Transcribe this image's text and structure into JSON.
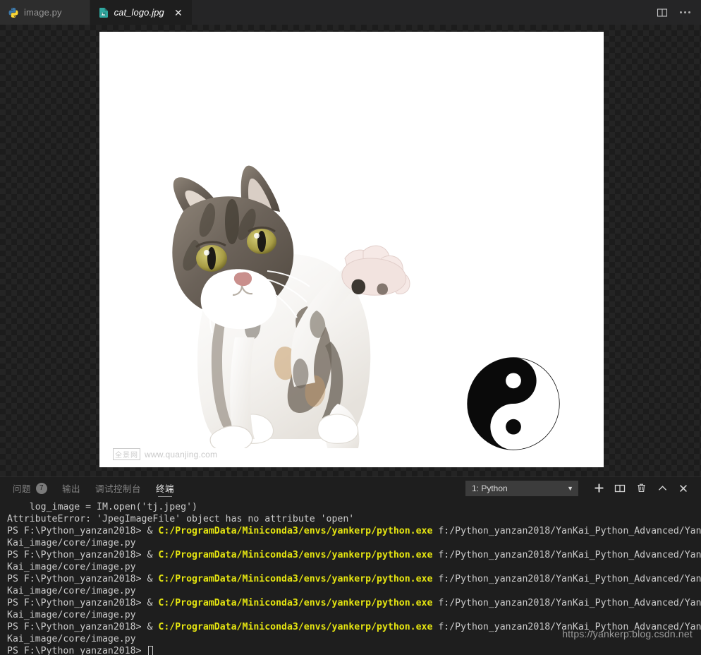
{
  "tabbar": {
    "tabs": [
      {
        "label": "image.py",
        "icon": "python-file-icon",
        "active": false
      },
      {
        "label": "cat_logo.jpg",
        "icon": "image-file-icon",
        "active": true
      }
    ],
    "close_glyph": "✕",
    "actions": [
      {
        "name": "split-editor-icon",
        "label": "Split Editor"
      },
      {
        "name": "more-actions-icon",
        "label": "More Actions..."
      }
    ]
  },
  "editor": {
    "image_name": "cat_logo.jpg",
    "image_watermark": {
      "brand": "全景网",
      "url": "www.quanjing.com"
    },
    "content": {
      "subject": "tabby-kitten-raised-paw",
      "overlay": "yin-yang-symbol"
    }
  },
  "panel": {
    "tabs": [
      {
        "label": "问题",
        "badge": "7",
        "active": false
      },
      {
        "label": "输出",
        "badge": "",
        "active": false
      },
      {
        "label": "调试控制台",
        "badge": "",
        "active": false
      },
      {
        "label": "终端",
        "badge": "",
        "active": true
      }
    ],
    "terminal_select": {
      "value": "1: Python",
      "caret": "▼"
    },
    "actions": [
      {
        "name": "new-terminal-icon",
        "glyph": "+"
      },
      {
        "name": "split-terminal-icon",
        "glyph": "split"
      },
      {
        "name": "kill-terminal-icon",
        "glyph": "trash"
      },
      {
        "name": "maximize-panel-icon",
        "glyph": "chevron-up"
      },
      {
        "name": "close-panel-icon",
        "glyph": "✕"
      }
    ]
  },
  "terminal": {
    "lines": [
      [
        {
          "t": "    log_image = IM.open('tj.jpeg')",
          "c": "plain"
        }
      ],
      [
        {
          "t": "AttributeError: 'JpegImageFile' object has no attribute 'open'",
          "c": "plain"
        }
      ],
      [
        {
          "t": "PS F:\\Python_yanzan2018> & ",
          "c": "plain"
        },
        {
          "t": "C:/ProgramData/Miniconda3/envs/yankerp/python.exe",
          "c": "yellow"
        },
        {
          "t": " f:/Python_yanzan2018/YanKai_Python_Advanced/Yan",
          "c": "plain"
        }
      ],
      [
        {
          "t": "Kai_image/core/image.py",
          "c": "plain"
        }
      ],
      [
        {
          "t": "PS F:\\Python_yanzan2018> & ",
          "c": "plain"
        },
        {
          "t": "C:/ProgramData/Miniconda3/envs/yankerp/python.exe",
          "c": "yellow"
        },
        {
          "t": " f:/Python_yanzan2018/YanKai_Python_Advanced/Yan",
          "c": "plain"
        }
      ],
      [
        {
          "t": "Kai_image/core/image.py",
          "c": "plain"
        }
      ],
      [
        {
          "t": "PS F:\\Python_yanzan2018> & ",
          "c": "plain"
        },
        {
          "t": "C:/ProgramData/Miniconda3/envs/yankerp/python.exe",
          "c": "yellow"
        },
        {
          "t": " f:/Python_yanzan2018/YanKai_Python_Advanced/Yan",
          "c": "plain"
        }
      ],
      [
        {
          "t": "Kai_image/core/image.py",
          "c": "plain"
        }
      ],
      [
        {
          "t": "PS F:\\Python_yanzan2018> & ",
          "c": "plain"
        },
        {
          "t": "C:/ProgramData/Miniconda3/envs/yankerp/python.exe",
          "c": "yellow"
        },
        {
          "t": " f:/Python_yanzan2018/YanKai_Python_Advanced/Yan",
          "c": "plain"
        }
      ],
      [
        {
          "t": "Kai_image/core/image.py",
          "c": "plain"
        }
      ],
      [
        {
          "t": "PS F:\\Python_yanzan2018> & ",
          "c": "plain"
        },
        {
          "t": "C:/ProgramData/Miniconda3/envs/yankerp/python.exe",
          "c": "yellow"
        },
        {
          "t": " f:/Python_yanzan2018/YanKai_Python_Advanced/Yan",
          "c": "plain"
        }
      ],
      [
        {
          "t": "Kai_image/core/image.py",
          "c": "plain"
        }
      ],
      [
        {
          "t": "PS F:\\Python_yanzan2018> ",
          "c": "plain"
        },
        {
          "t": "",
          "c": "cursor"
        }
      ]
    ]
  },
  "watermark": {
    "url": "https://yankerp.blog.csdn.net"
  },
  "colors": {
    "editor_bg": "#1e1e1e",
    "tab_active_bg": "#1e1e1e",
    "tab_inactive_bg": "#2d2d2d",
    "terminal_yellow": "#e5e510",
    "terminal_text": "#cccccc",
    "badge_bg": "#7a7a7a"
  }
}
